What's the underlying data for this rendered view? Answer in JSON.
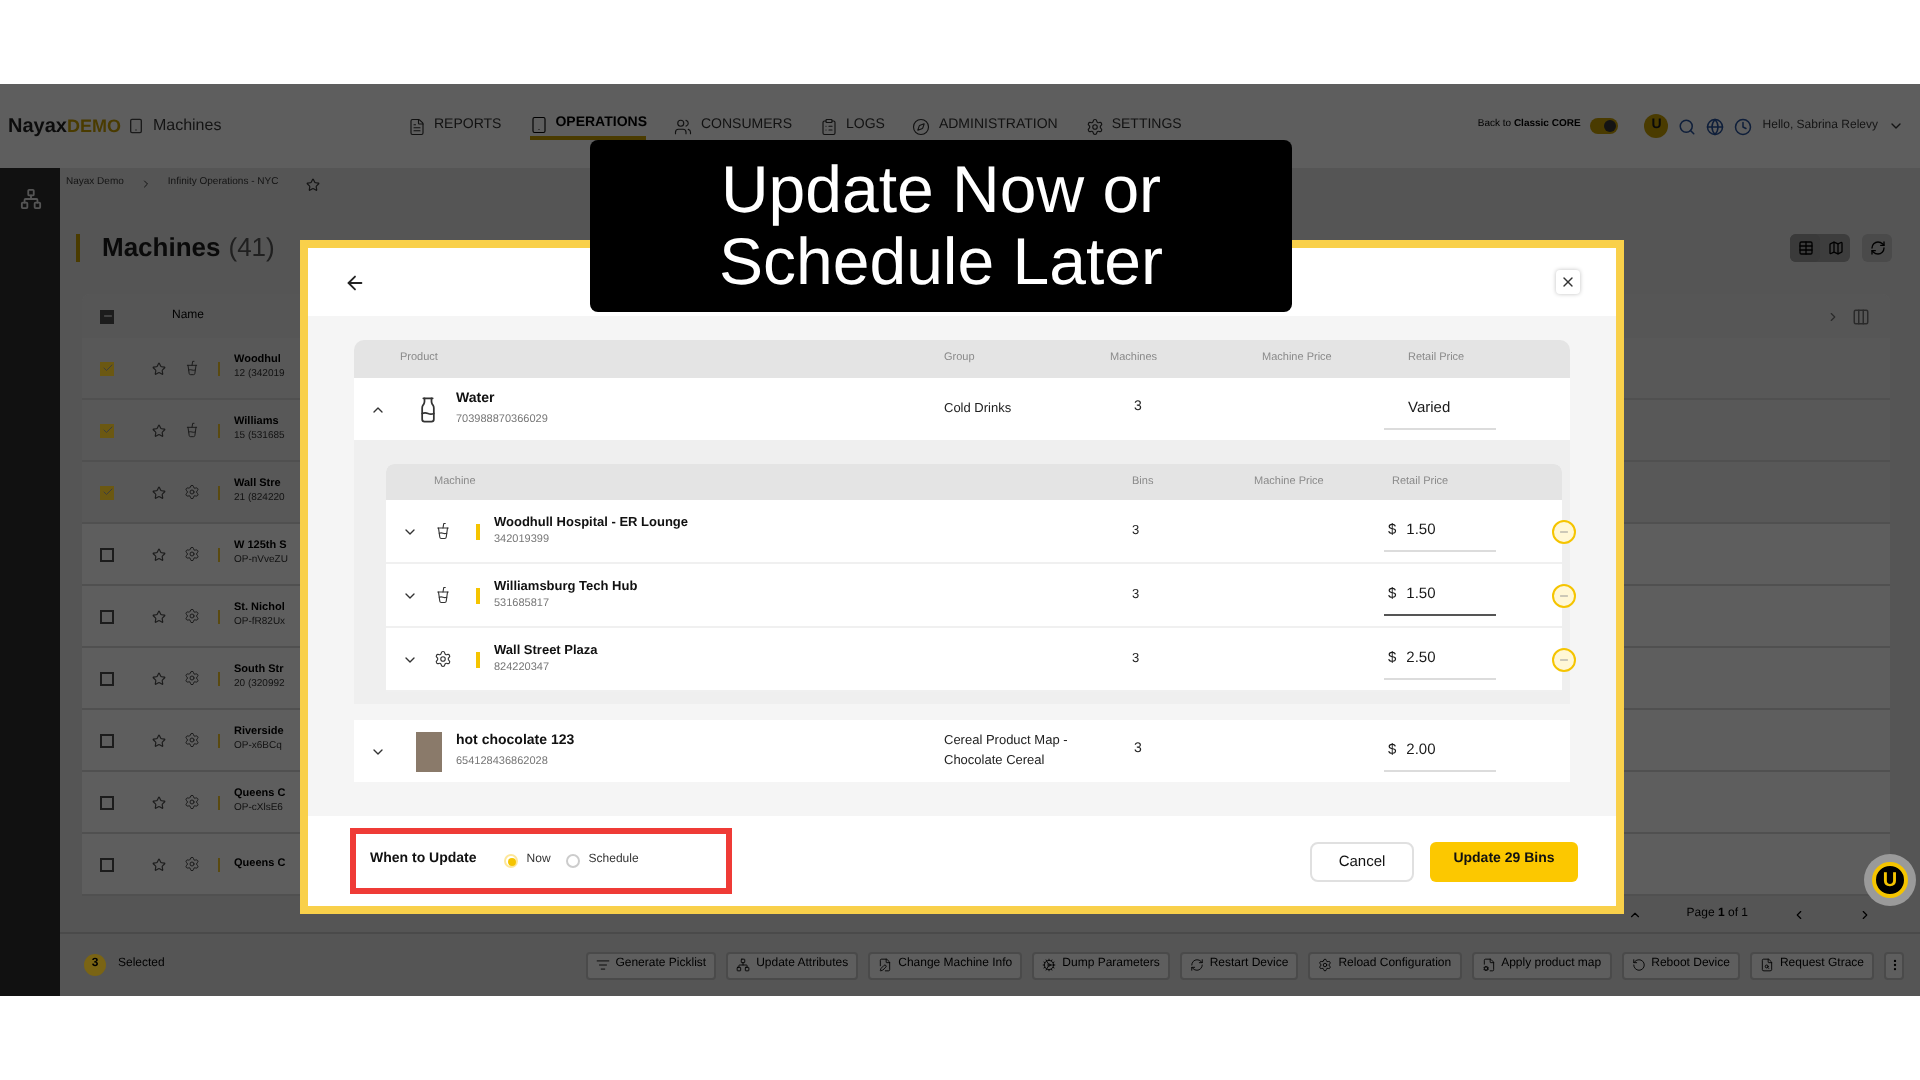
{
  "caption": {
    "lines": [
      "Update Now or",
      "Schedule Later"
    ]
  },
  "header": {
    "logo": "Nayax",
    "logo_suffix": "DEMO",
    "app": "Machines",
    "nav": [
      {
        "label": "REPORTS",
        "selected": false,
        "kind": "report"
      },
      {
        "label": "OPERATIONS",
        "selected": true,
        "kind": "tablet"
      },
      {
        "label": "CONSUMERS",
        "selected": false,
        "kind": "consumer"
      },
      {
        "label": "LOGS",
        "selected": false,
        "kind": "log"
      },
      {
        "label": "ADMINISTRATION",
        "selected": false,
        "kind": "admin"
      },
      {
        "label": "SETTINGS",
        "selected": false,
        "kind": "settings"
      }
    ],
    "classic_toggle": {
      "label": "Back to **Classic CORE**",
      "on": true
    },
    "logo_badge": "U",
    "greeting": "Hello, Sabrina Relevy"
  },
  "breadcrumb": [
    "Nayax Demo",
    "Infinity Operations - NYC"
  ],
  "page": {
    "title": "Machines",
    "count": "(41)"
  },
  "table": {
    "columns": [
      "Name"
    ],
    "indeterminate": true,
    "rows": [
      {
        "name": "Woodhul",
        "sub": "12 (342019",
        "checked": true,
        "kind": "cup"
      },
      {
        "name": "Williams",
        "sub": "15 (531685",
        "checked": true,
        "kind": "cup"
      },
      {
        "name": "Wall Stre",
        "sub": "21 (824220",
        "checked": true,
        "kind": "gear"
      },
      {
        "name": "W 125th S",
        "sub": "OP-nVveZU",
        "checked": false,
        "kind": "gear"
      },
      {
        "name": "St. Nichol",
        "sub": "OP-fR82Ux",
        "checked": false,
        "kind": "gear"
      },
      {
        "name": "South Str",
        "sub": "20 (320992",
        "checked": false,
        "kind": "gear"
      },
      {
        "name": "Riverside",
        "sub": "OP-x6BCq",
        "checked": false,
        "kind": "gear"
      },
      {
        "name": "Queens C",
        "sub": "OP-cXlsE6",
        "checked": false,
        "kind": "gear"
      },
      {
        "name": "Queens C",
        "checked": false,
        "kind": "gear"
      }
    ]
  },
  "pagination": "Page **1** of 1",
  "selection": {
    "count": "3",
    "label": "Selected"
  },
  "actions": [
    "Generate Picklist",
    "Update Attributes",
    "Change Machine Info",
    "Dump Parameters",
    "Restart Device",
    "Reload Configuration",
    "Apply product map",
    "Reboot Device",
    "Request Gtrace"
  ],
  "assistant_badge": "U",
  "modal": {
    "product_columns": [
      "Product",
      "Group",
      "Machines",
      "Machine Price",
      "Retail Price"
    ],
    "machine_columns": [
      "Machine",
      "Bins",
      "Machine Price",
      "Retail Price"
    ],
    "products": [
      {
        "name": "Water",
        "code": "703988870366029",
        "group": "Cold Drinks",
        "machines": "3",
        "retail_price": "Varied",
        "expanded": true,
        "kind": "bottle",
        "machine_rows": [
          {
            "name": "Woodhull Hospital - ER Lounge",
            "code": "342019399",
            "bins": "3",
            "currency": "$",
            "price": "1.50",
            "focused": false,
            "kind": "cup"
          },
          {
            "name": "Williamsburg Tech Hub",
            "code": "531685817",
            "bins": "3",
            "currency": "$",
            "price": "1.50",
            "focused": true,
            "kind": "cup"
          },
          {
            "name": "Wall Street Plaza",
            "code": "824220347",
            "bins": "3",
            "currency": "$",
            "price": "2.50",
            "focused": false,
            "kind": "gear"
          }
        ]
      },
      {
        "name": "hot chocolate 123",
        "code": "654128436862028",
        "group": "Cereal Product Map - Chocolate Cereal",
        "machines": "3",
        "currency": "$",
        "retail_price": "2.00",
        "expanded": false,
        "kind": "photo"
      }
    ],
    "when_to_update": {
      "label": "When to Update",
      "options": [
        {
          "label": "Now",
          "selected": true
        },
        {
          "label": "Schedule",
          "selected": false
        }
      ]
    },
    "cancel": "Cancel",
    "submit": "Update 29 Bins"
  }
}
